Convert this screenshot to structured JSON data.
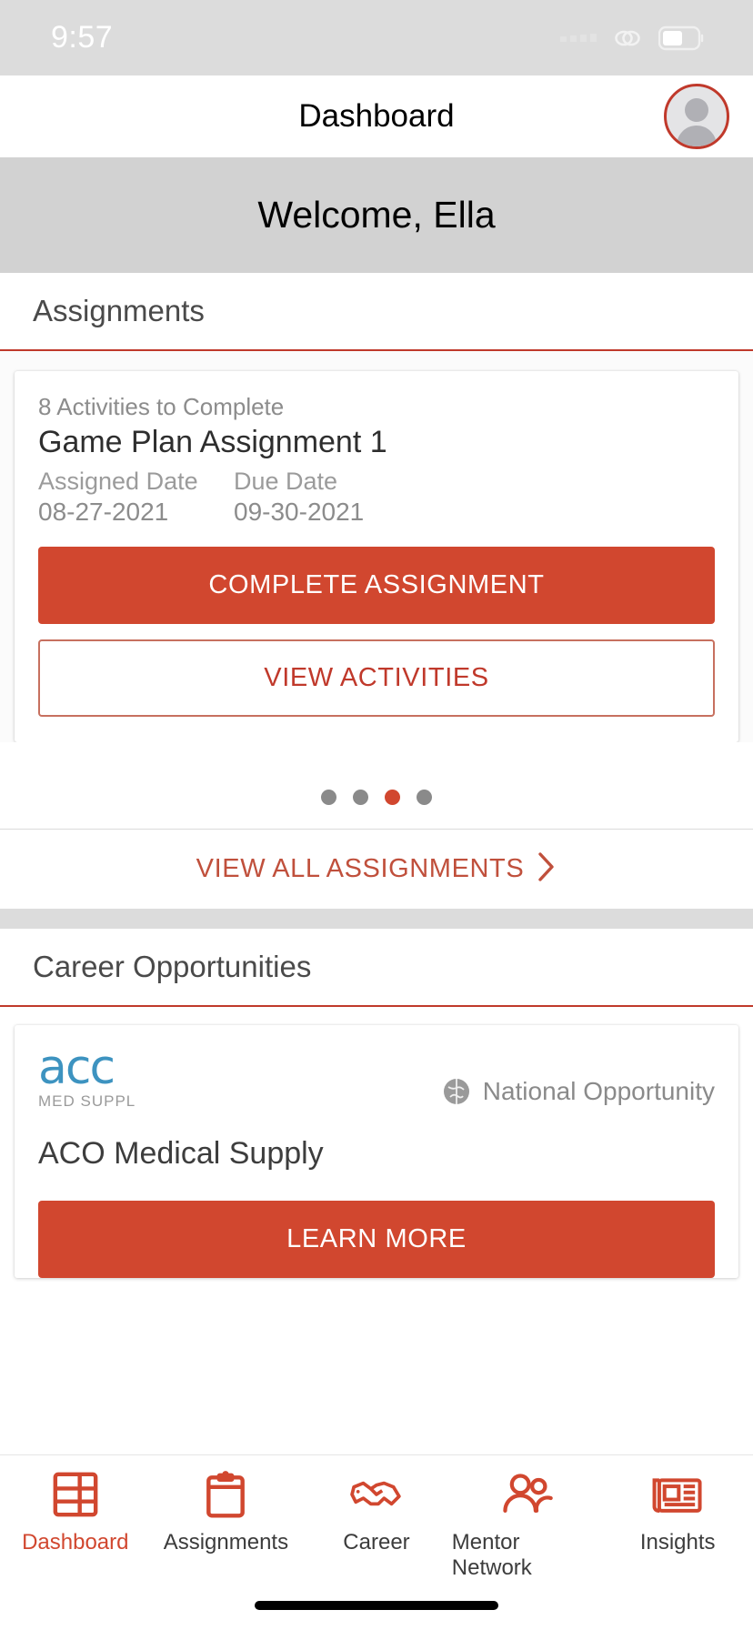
{
  "status_bar": {
    "time": "9:57",
    "icons": [
      "signal-dots-icon",
      "link-icon",
      "battery-icon"
    ]
  },
  "navbar": {
    "title": "Dashboard",
    "avatar_name": "profile-avatar"
  },
  "welcome": {
    "text": "Welcome, Ella"
  },
  "assignments_section": {
    "title": "Assignments",
    "card": {
      "activities_count": "8 Activities to Complete",
      "name": "Game Plan Assignment  1",
      "assigned_date_label": "Assigned Date",
      "due_date_label": "Due Date",
      "assigned_date": "08-27-2021",
      "due_date": "09-30-2021",
      "primary_button": "COMPLETE ASSIGNMENT",
      "secondary_button": "VIEW ACTIVITIES"
    },
    "pagination": {
      "total": 4,
      "active_index": 2
    },
    "view_all_label": "VIEW ALL ASSIGNMENTS",
    "view_all_chevron": "chevron-right-icon"
  },
  "career_section": {
    "title": "Career Opportunities",
    "card": {
      "logo_word": "acc",
      "logo_sub": "MED SUPPL",
      "badge_icon": "globe-icon",
      "badge_text": "National Opportunity",
      "company": "ACO Medical Supply",
      "button": "LEARN MORE"
    }
  },
  "tabbar": {
    "items": [
      {
        "label": "Dashboard",
        "icon": "dashboard-grid-icon",
        "active": true
      },
      {
        "label": "Assignments",
        "icon": "clipboard-icon",
        "active": false
      },
      {
        "label": "Career",
        "icon": "handshake-icon",
        "active": false
      },
      {
        "label": "Mentor Network",
        "icon": "people-icon",
        "active": false
      },
      {
        "label": "Insights",
        "icon": "newspaper-icon",
        "active": false
      }
    ]
  },
  "colors": {
    "accent": "#d1472f",
    "accent_dark": "#c0392b",
    "logo_blue": "#3d93c0",
    "welcome_bg": "#d2d2d2",
    "status_bg": "#dcdcdc"
  }
}
